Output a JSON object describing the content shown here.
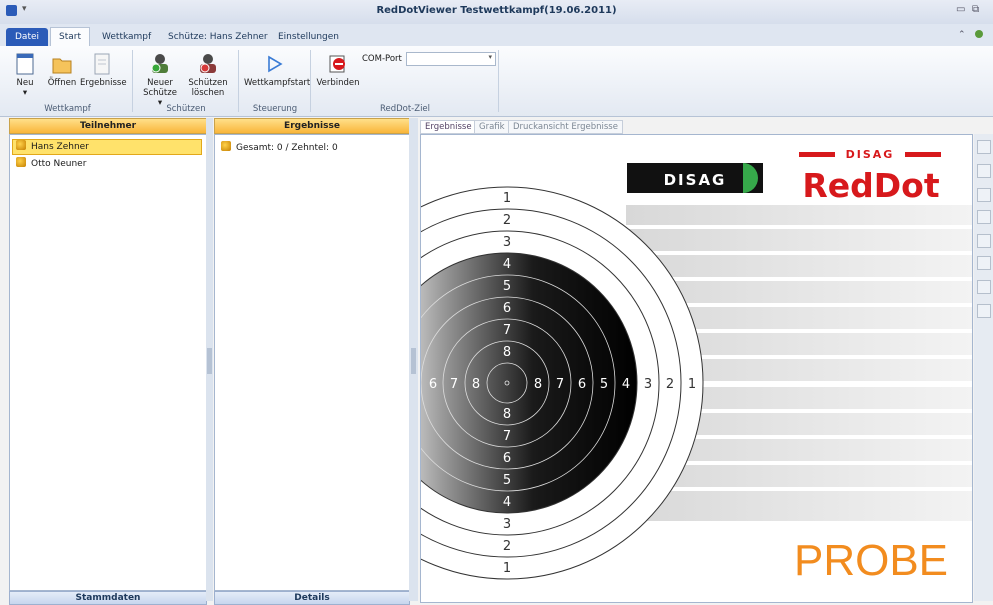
{
  "window": {
    "title": "RedDotViewer Testwettkampf(19.06.2011)"
  },
  "tabs": {
    "file": "Datei",
    "start": "Start",
    "wettkampf": "Wettkampf",
    "schuetze": "Schütze: Hans Zehner",
    "einstellungen": "Einstellungen"
  },
  "ribbon": {
    "neu": "Neu",
    "oeffnen": "Öffnen",
    "ergebnisse": "Ergebnisse",
    "neuer_schuetze_1": "Neuer",
    "neuer_schuetze_2": "Schütze ▾",
    "schuetzen_loeschen_1": "Schützen",
    "schuetzen_loeschen_2": "löschen",
    "wettkampfstart": "Wettkampfstart",
    "verbinden": "Verbinden",
    "com_port_label": "COM-Port",
    "com_port_value": "",
    "groups": {
      "wettkampf": "Wettkampf",
      "schuetzen": "Schützen",
      "steuerung": "Steuerung",
      "reddot": "RedDot-Ziel"
    }
  },
  "participants": {
    "header": "Teilnehmer",
    "items": [
      "Hans Zehner",
      "Otto Neuner"
    ],
    "footer": "Stammdaten"
  },
  "results": {
    "header": "Ergebnisse",
    "items": [
      "Gesamt: 0 / Zehntel: 0"
    ],
    "footer": "Details"
  },
  "view_tabs": [
    "Ergebnisse",
    "Grafik",
    "Druckansicht Ergebnisse"
  ],
  "target": {
    "logo_left": "DISAG",
    "logo_right_top": "DISAG",
    "logo_right_main": "RedDot",
    "stamp": "PROBE",
    "ring_numbers_top": [
      "1",
      "2",
      "3",
      "4",
      "5",
      "6",
      "7",
      "8"
    ],
    "ring_numbers_bottom": [
      "8",
      "7",
      "6",
      "5",
      "4",
      "3",
      "2",
      "1"
    ],
    "ring_numbers_right": [
      "8",
      "7",
      "6",
      "5",
      "4",
      "3",
      "2",
      "1"
    ],
    "ring_numbers_left": [
      "6",
      "7",
      "8"
    ]
  },
  "colors": {
    "accent_orange": "#f28c1f",
    "red": "#d7191c",
    "green": "#36a84a",
    "tab_blue": "#2b5bb8"
  }
}
